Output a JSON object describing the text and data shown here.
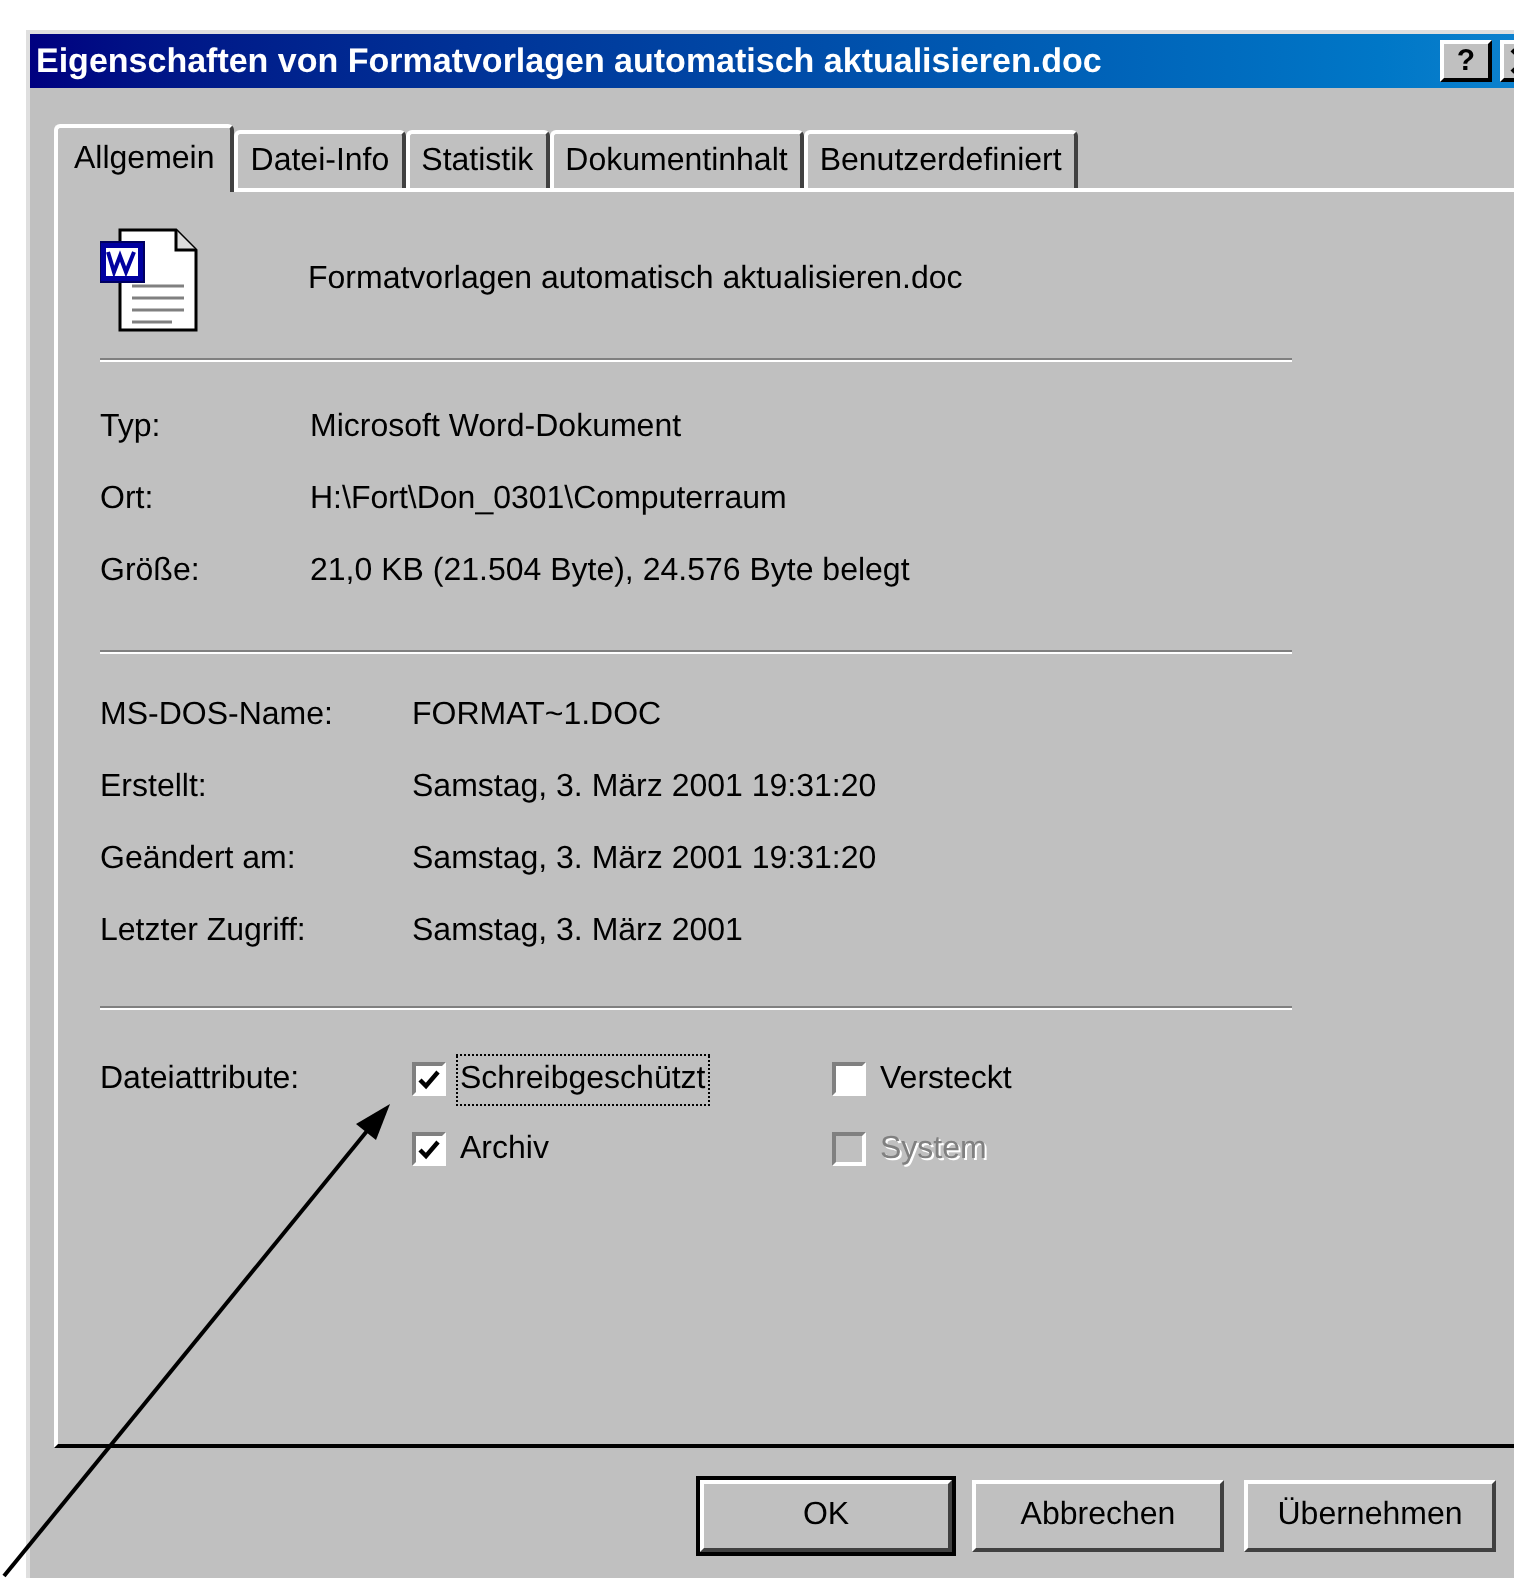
{
  "window": {
    "title": "Eigenschaften von Formatvorlagen automatisch aktualisieren.doc",
    "help_button": "?"
  },
  "tabs": [
    {
      "label": "Allgemein",
      "selected": true
    },
    {
      "label": "Datei-Info",
      "selected": false
    },
    {
      "label": "Statistik",
      "selected": false
    },
    {
      "label": "Dokumentinhalt",
      "selected": false
    },
    {
      "label": "Benutzerdefiniert",
      "selected": false
    }
  ],
  "file_name": "Formatvorlagen automatisch aktualisieren.doc",
  "info": [
    {
      "label": "Typ:",
      "value": "Microsoft Word-Dokument"
    },
    {
      "label": "Ort:",
      "value": "H:\\Fort\\Don_0301\\Computerraum"
    },
    {
      "label": "Größe:",
      "value": "21,0 KB (21.504 Byte), 24.576 Byte belegt"
    }
  ],
  "dates": [
    {
      "label": "MS-DOS-Name:",
      "value": "FORMAT~1.DOC"
    },
    {
      "label": "Erstellt:",
      "value": "Samstag, 3. März 2001 19:31:20"
    },
    {
      "label": "Geändert am:",
      "value": "Samstag, 3. März 2001 19:31:20"
    },
    {
      "label": "Letzter Zugriff:",
      "value": "Samstag, 3. März 2001"
    }
  ],
  "attributes": {
    "label": "Dateiattribute:",
    "items": [
      {
        "label": "Schreibgeschützt",
        "checked": true,
        "disabled": false,
        "focused": true
      },
      {
        "label": "Versteckt",
        "checked": false,
        "disabled": false,
        "focused": false
      },
      {
        "label": "Archiv",
        "checked": true,
        "disabled": false,
        "focused": false
      },
      {
        "label": "System",
        "checked": false,
        "disabled": true,
        "focused": false
      }
    ]
  },
  "buttons": [
    {
      "label": "OK",
      "default": true
    },
    {
      "label": "Abbrechen",
      "default": false
    },
    {
      "label": "Übernehmen",
      "default": false
    }
  ]
}
